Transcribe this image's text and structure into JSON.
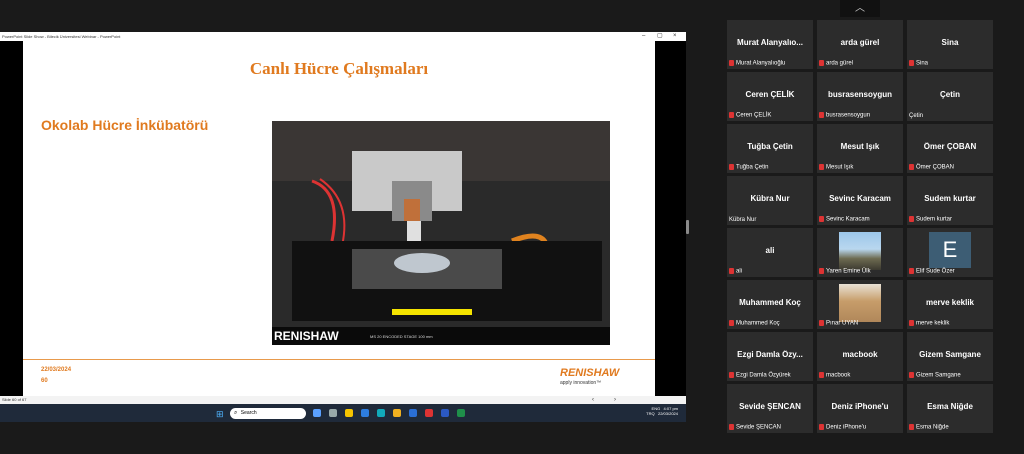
{
  "ppt": {
    "window_title": "PowerPoint Slide Show  -  Bilecik Üniversitesi Webinar - PowerPoint",
    "controls": {
      "minimize": "–",
      "restore": "▢",
      "close": "×"
    },
    "slide": {
      "title": "Canlı Hücre Çalışmaları",
      "subtitle": "Okolab Hücre İnkübatörü",
      "date": "22/03/2024",
      "number": "60",
      "logo": "RENISHAW",
      "tagline": "apply innovation™",
      "photo_text": "RENISHAW",
      "photo_caption": "MS 20 ENCODED STAGE 100 mm"
    },
    "status": {
      "slide_counter": "Slide 60 of 67"
    }
  },
  "taskbar": {
    "search_placeholder": "Search",
    "tray_lang_1": "ENG",
    "tray_lang_2": "TRQ",
    "time": "4:07 pm",
    "date": "22/03/2024"
  },
  "gallery": {
    "collapse_icon": "chevron-up-icon",
    "participants": [
      {
        "name": "Murat  Alanyalıo...",
        "label": "Murat Alanyalıoğlu",
        "muted": true
      },
      {
        "name": "arda gürel",
        "label": "arda gürel",
        "muted": true
      },
      {
        "name": "Sina",
        "label": "Sina",
        "muted": true
      },
      {
        "name": "Ceren ÇELİK",
        "label": "Ceren ÇELİK",
        "muted": true
      },
      {
        "name": "busrasensoygun",
        "label": "busrasensoygun",
        "muted": true
      },
      {
        "name": "Çetin",
        "label": "Çetin",
        "muted": false
      },
      {
        "name": "Tuğba Çetin",
        "label": "Tuğba Çetin",
        "muted": true
      },
      {
        "name": "Mesut Işık",
        "label": "Mesut Işık",
        "muted": true
      },
      {
        "name": "Ömer ÇOBAN",
        "label": "Ömer ÇOBAN",
        "muted": true
      },
      {
        "name": "Kübra Nur",
        "label": "Kübra Nur",
        "muted": false
      },
      {
        "name": "Sevinc Karacam",
        "label": "Sevinc Karacam",
        "muted": true
      },
      {
        "name": "Sudem kurtar",
        "label": "Sudem kurtar",
        "muted": true
      },
      {
        "name": "ali",
        "label": "ali",
        "muted": true
      },
      {
        "name": "",
        "label": "Yaren Emine Ülk",
        "muted": true,
        "avatar": "photo"
      },
      {
        "name": "",
        "label": "Elif Sude Özer",
        "muted": true,
        "avatar": "E"
      },
      {
        "name": "Muhammed Koç",
        "label": "Muhammed Koç",
        "muted": true
      },
      {
        "name": "",
        "label": "Pınar UYAN",
        "muted": true,
        "avatar": "photo2"
      },
      {
        "name": "merve keklik",
        "label": "merve keklik",
        "muted": true
      },
      {
        "name": "Ezgi  Damla  Özy...",
        "label": "Ezgi Damla Özyürek",
        "muted": true
      },
      {
        "name": "macbook",
        "label": "macbook",
        "muted": true
      },
      {
        "name": "Gizem Samgane",
        "label": "Gizem Samgane",
        "muted": true
      },
      {
        "name": "Sevide ŞENCAN",
        "label": "Sevide ŞENCAN",
        "muted": true
      },
      {
        "name": "Deniz iPhone'u",
        "label": "Deniz iPhone'u",
        "muted": true
      },
      {
        "name": "Esma Niğde",
        "label": "Esma Niğde",
        "muted": true
      }
    ]
  }
}
